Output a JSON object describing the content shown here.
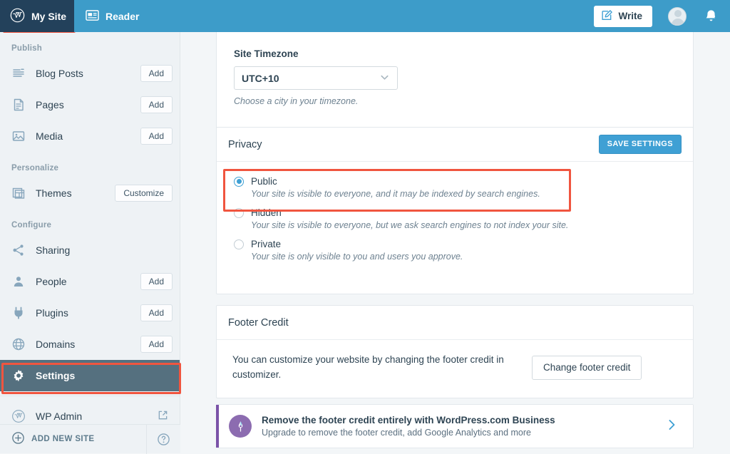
{
  "masterbar": {
    "my_site": {
      "label": "My Site",
      "icon": "wordpress-icon"
    },
    "reader": {
      "label": "Reader",
      "icon": "reader-icon"
    },
    "write": {
      "label": "Write",
      "icon": "pencil-icon"
    },
    "avatar_icon": "avatar-icon",
    "bell_icon": "bell-icon",
    "background_color": "#3d9cc9",
    "active_background_color": "#23415b"
  },
  "sidebar": {
    "sections": [
      {
        "heading": "Publish",
        "items": [
          {
            "label": "Blog Posts",
            "icon": "posts-icon",
            "action": "Add"
          },
          {
            "label": "Pages",
            "icon": "pages-icon",
            "action": "Add"
          },
          {
            "label": "Media",
            "icon": "media-icon",
            "action": "Add"
          }
        ]
      },
      {
        "heading": "Personalize",
        "items": [
          {
            "label": "Themes",
            "icon": "themes-icon",
            "action": "Customize"
          }
        ]
      },
      {
        "heading": "Configure",
        "items": [
          {
            "label": "Sharing",
            "icon": "sharing-icon",
            "action": ""
          },
          {
            "label": "People",
            "icon": "people-icon",
            "action": "Add"
          },
          {
            "label": "Plugins",
            "icon": "plugins-icon",
            "action": "Add"
          },
          {
            "label": "Domains",
            "icon": "domains-icon",
            "action": "Add"
          },
          {
            "label": "Settings",
            "icon": "gear-icon",
            "action": "",
            "selected": true
          },
          {
            "label": "WP Admin",
            "icon": "wordpress-icon",
            "action": "",
            "external": true
          }
        ]
      }
    ],
    "footer": {
      "add_new_site": "ADD NEW SITE",
      "add_icon": "plus-circle-icon",
      "help_icon": "help-circle-icon"
    },
    "selected_background_color": "#55707f"
  },
  "main": {
    "timezone_card": {
      "label": "Site Timezone",
      "value": "UTC+10",
      "chevron_icon": "chevron-down-icon",
      "help_text": "Choose a city in your timezone."
    },
    "privacy_card": {
      "title": "Privacy",
      "save_label": "SAVE SETTINGS",
      "options": [
        {
          "label": "Public",
          "description": "Your site is visible to everyone, and it may be indexed by search engines.",
          "selected": true
        },
        {
          "label": "Hidden",
          "description": "Your site is visible to everyone, but we ask search engines to not index your site.",
          "selected": false
        },
        {
          "label": "Private",
          "description": "Your site is only visible to you and users you approve.",
          "selected": false
        }
      ]
    },
    "footer_credit_card": {
      "title": "Footer Credit",
      "description": "You can customize your website by changing the footer credit in customizer.",
      "button_label": "Change footer credit"
    },
    "upgrade_banner": {
      "icon": "pen-nib-icon",
      "title": "Remove the footer credit entirely with WordPress.com Business",
      "subtitle": "Upgrade to remove the footer credit, add Google Analytics and more",
      "chevron_icon": "chevron-right-icon",
      "accent_color": "#7b53a8"
    }
  },
  "highlights": {
    "color": "#f0553f",
    "regions": [
      "my-site-button",
      "settings-sidebar-item",
      "public-privacy-option"
    ]
  }
}
